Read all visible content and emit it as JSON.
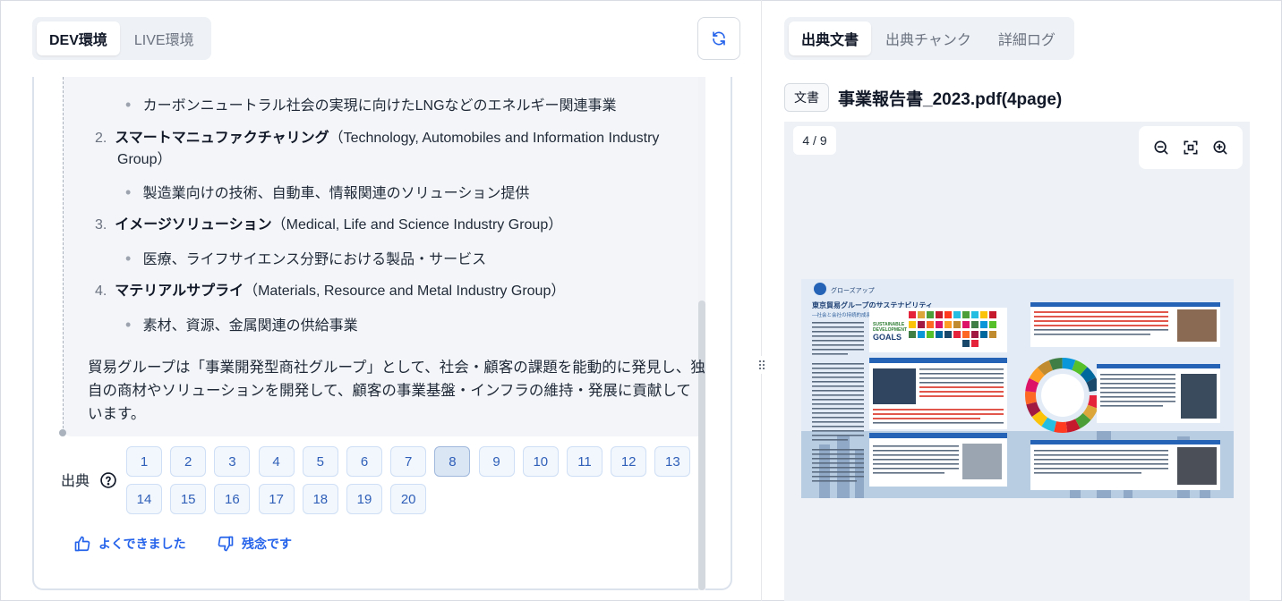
{
  "env_tabs": [
    "DEV環境",
    "LIVE環境"
  ],
  "answer": {
    "bullet_lng": "カーボンニュートラル社会の実現に向けたLNGなどのエネルギー関連事業",
    "item2": {
      "num": "2.",
      "title": "スマートマニュファクチャリング",
      "en_line1": "（Technology, Automobiles and Information Industry",
      "en_line2": "Group）",
      "desc": "製造業向けの技術、自動車、情報関連のソリューション提供"
    },
    "item3": {
      "num": "3.",
      "title": "イメージソリューション",
      "en": "（Medical, Life and Science Industry Group）",
      "desc": "医療、ライフサイエンス分野における製品・サービス"
    },
    "item4": {
      "num": "4.",
      "title": "マテリアルサプライ",
      "en": "（Materials, Resource and Metal Industry Group）",
      "desc": "素材、資源、金属関連の供給事業"
    },
    "summary_line1": "貿易グループは「事業開発型商社グループ」として、社会・顧客の課題を能動的に発見し、独",
    "summary_line2": "自の商材やソリューションを開発して、顧客の事業基盤・インフラの維持・発展に貢献して",
    "summary_line3": "います。"
  },
  "sources": {
    "label": "出典",
    "numbers": [
      "1",
      "2",
      "3",
      "4",
      "5",
      "6",
      "7",
      "8",
      "9",
      "10",
      "11",
      "12",
      "13",
      "14",
      "15",
      "16",
      "17",
      "18",
      "19",
      "20"
    ],
    "selected": "8"
  },
  "feedback": {
    "good": "よくできました",
    "bad": "残念です"
  },
  "source_tabs": [
    "出典文書",
    "出典チャンク",
    "詳細ログ"
  ],
  "document": {
    "badge": "文書",
    "title": "事業報告書_2023.pdf(4page)",
    "page_indicator": "4 / 9"
  },
  "pdf_page": {
    "header": "グローズアップ",
    "heading": "東京貿易グループのサステナビリティ",
    "subheading": "―社会と会社の持続的成長へ―",
    "sdgs_line1": "SUSTAINABLE",
    "sdgs_line2": "DEVELOPMENT",
    "sdgs_line3": "GOALS"
  },
  "colors": {
    "accent": "#2563eb",
    "source_text": "#2f5fb8",
    "tab_bg": "#eef1f5"
  }
}
